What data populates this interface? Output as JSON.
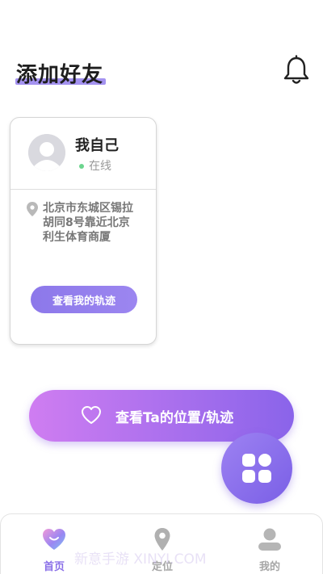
{
  "header": {
    "title": "添加好友",
    "bell_icon": "bell-icon"
  },
  "self_card": {
    "name": "我自己",
    "status": "在线",
    "address": "北京市东城区锡拉胡同8号靠近北京利生体育商厦",
    "track_button_label": "查看我的轨迹"
  },
  "main_action": {
    "label": "查看Ta的位置/轨迹",
    "icon": "heart-icon"
  },
  "fab": {
    "icon": "grid-icon"
  },
  "tabbar": {
    "tabs": [
      {
        "label": "首页",
        "icon": "home-heart-icon",
        "active": true
      },
      {
        "label": "定位",
        "icon": "location-pin-icon",
        "active": false
      },
      {
        "label": "我的",
        "icon": "person-icon",
        "active": false
      }
    ]
  },
  "watermark": "新意手游 XINYI.COM",
  "colors": {
    "accent": "#8a6fe8",
    "gradient_start": "#cf7df1",
    "gradient_end": "#8a64ea",
    "online": "#6cd58e"
  }
}
